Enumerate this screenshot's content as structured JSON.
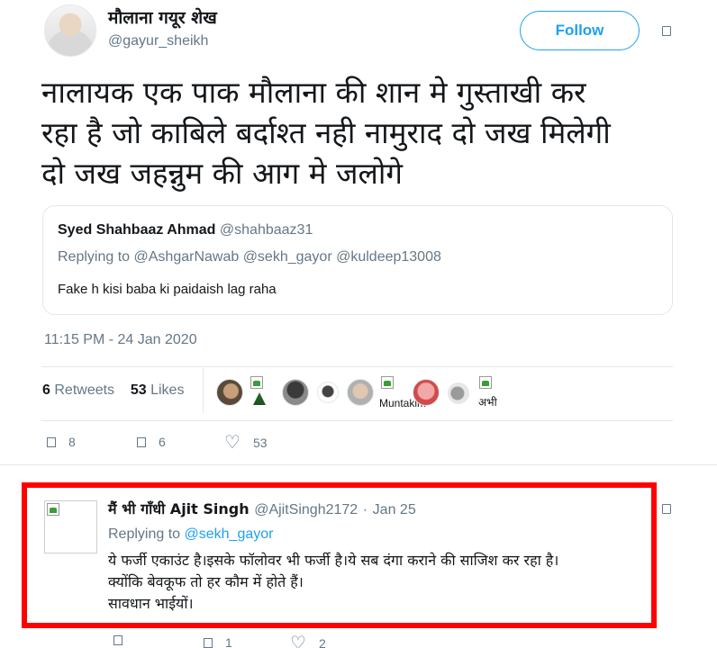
{
  "tweet": {
    "author_name": "मौलाना गयूर शेख",
    "author_handle": "@gayur_sheikh",
    "follow_label": "Follow",
    "text_lines": [
      "नालायक एक पाक मौलाना की शान मे गुस्ताखी कर",
      "रहा है जो काबिले बर्दाश्त नही नामुराद दो जख मिलेगी",
      "दो जख जहन्नुम की आग मे जलोगे"
    ],
    "quoted": {
      "name": "Syed Shahbaaz Ahmad",
      "handle": "@shahbaaz31",
      "replying_prefix": "Replying to",
      "replying_to": "@AshgarNawab @sekh_gayor @kuldeep13008",
      "text": "Fake h kisi baba ki paidaish lag raha"
    },
    "timestamp": "11:15 PM - 24 Jan 2020",
    "retweets_count": "6",
    "retweets_label": "Retweets",
    "likes_count": "53",
    "likes_label": "Likes",
    "liker_labels": [
      "Muntakim",
      "अभी"
    ],
    "actions": {
      "reply": "8",
      "retweet": "6",
      "like": "53"
    }
  },
  "reply": {
    "name": "मैं भी गाँधी Ajit Singh",
    "handle": "@AjitSingh2172",
    "separator": "·",
    "date": "Jan 25",
    "replying_prefix": "Replying to",
    "replying_to": "@sekh_gayor",
    "text_lines": [
      "ये फर्जी एकाउंट है।इसके फॉलोवर भी फर्जी है।ये सब दंगा कराने की साजिश कर रहा है।",
      "क्योंकि बेवकूफ तो हर कौम में होते हैं।",
      "सावधान भाईयों।"
    ],
    "actions": {
      "reply": "",
      "retweet": "1",
      "like": "2"
    }
  },
  "colors": {
    "accent": "#1da1f2",
    "muted": "#657786",
    "highlight": "#ff0000"
  }
}
